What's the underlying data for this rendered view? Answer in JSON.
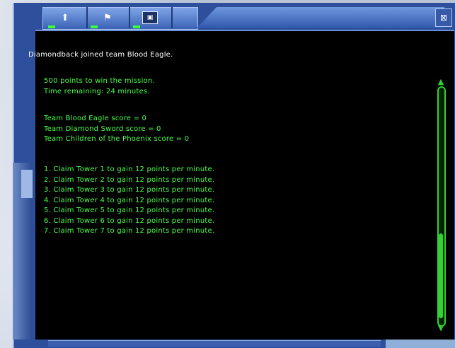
{
  "tabs": [
    {
      "icon": "pin-icon",
      "glyph": "⬆"
    },
    {
      "icon": "flag-icon",
      "glyph": "⚑"
    },
    {
      "icon": "hud-icon",
      "glyph": "▣"
    }
  ],
  "close_glyph": "⊠",
  "join_message": "Diamondback joined team Blood Eagle.",
  "mission": {
    "points_to_win": "500 points to win the mission.",
    "time_remaining": "Time remaining: 24 minutes."
  },
  "scores": [
    "Team Blood Eagle score = 0",
    "Team Diamond Sword score = 0",
    "Team Children of the Phoenix score = 0"
  ],
  "objectives": [
    "1. Claim Tower 1 to gain 12 points per minute.",
    "2. Claim Tower 2 to gain 12 points per minute.",
    "3. Claim Tower 3 to gain 12 points per minute.",
    "4. Claim Tower 4 to gain 12 points per minute.",
    "5. Claim Tower 5 to gain 12 points per minute.",
    "6. Claim Tower 6 to gain 12 points per minute.",
    "7. Claim Tower 7 to gain 12 points per minute."
  ],
  "scroll_arrows": {
    "up": "▲",
    "down": "▼"
  },
  "colors": {
    "accent": "#4cff4c",
    "frame": "#2d4f9c",
    "panel": "#000000"
  }
}
